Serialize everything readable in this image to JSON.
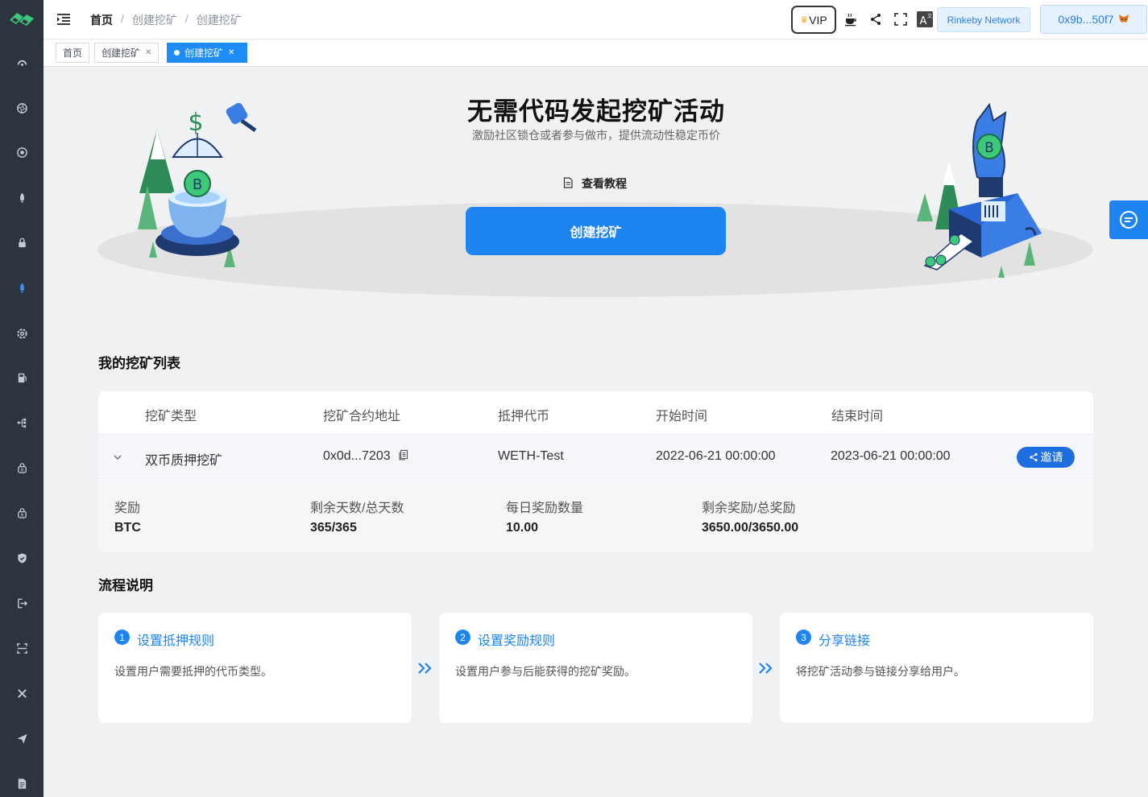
{
  "header": {
    "breadcrumb": [
      "首页",
      "创建挖矿",
      "创建挖矿"
    ],
    "vip_label": "VIP",
    "network": "Rinkeby Network",
    "wallet": "0x9b...50f7"
  },
  "tabs": [
    {
      "label": "首页",
      "closable": false,
      "active": false
    },
    {
      "label": "创建挖矿",
      "closable": true,
      "active": false
    },
    {
      "label": "创建挖矿",
      "closable": true,
      "active": true
    }
  ],
  "hero": {
    "title": "无需代码发起挖矿活动",
    "subtitle": "激励社区锁仓或者参与做市，提供流动性稳定币价",
    "tutorial": "查看教程",
    "create_button": "创建挖矿"
  },
  "mining_list": {
    "title": "我的挖矿列表",
    "headers": [
      "挖矿类型",
      "挖矿合约地址",
      "抵押代币",
      "开始时间",
      "结束时间"
    ],
    "row": {
      "type": "双币质押挖矿",
      "contract": "0x0d...7203",
      "token": "WETH-Test",
      "start": "2022-06-21 00:00:00",
      "end": "2023-06-21 00:00:00",
      "invite": "邀请"
    },
    "detail_labels": [
      "奖励",
      "剩余天数/总天数",
      "每日奖励数量",
      "剩余奖励/总奖励"
    ],
    "detail_values": [
      "BTC",
      "365/365",
      "10.00",
      "3650.00/3650.00"
    ]
  },
  "process": {
    "title": "流程说明",
    "steps": [
      {
        "num": "1",
        "title": "设置抵押规则",
        "desc": "设置用户需要抵押的代币类型。"
      },
      {
        "num": "2",
        "title": "设置奖励规则",
        "desc": "设置用户参与后能获得的挖矿奖励。"
      },
      {
        "num": "3",
        "title": "分享链接",
        "desc": "将挖矿活动参与链接分享给用户。"
      }
    ]
  },
  "colors": {
    "accent": "#1d84f0",
    "sidebar": "#2c3440"
  },
  "sidebar_icons": [
    "dashboard-icon",
    "aperture-icon",
    "badge-icon",
    "rocket-icon",
    "lock-icon",
    "rocket-active-icon",
    "gear-icon",
    "fuel-icon",
    "tree-icon",
    "bitcoin-lock-icon",
    "bitcoin-lock-icon-2",
    "shield-check-icon",
    "export-icon",
    "scan-icon",
    "tools-icon",
    "send-icon",
    "document-icon"
  ]
}
